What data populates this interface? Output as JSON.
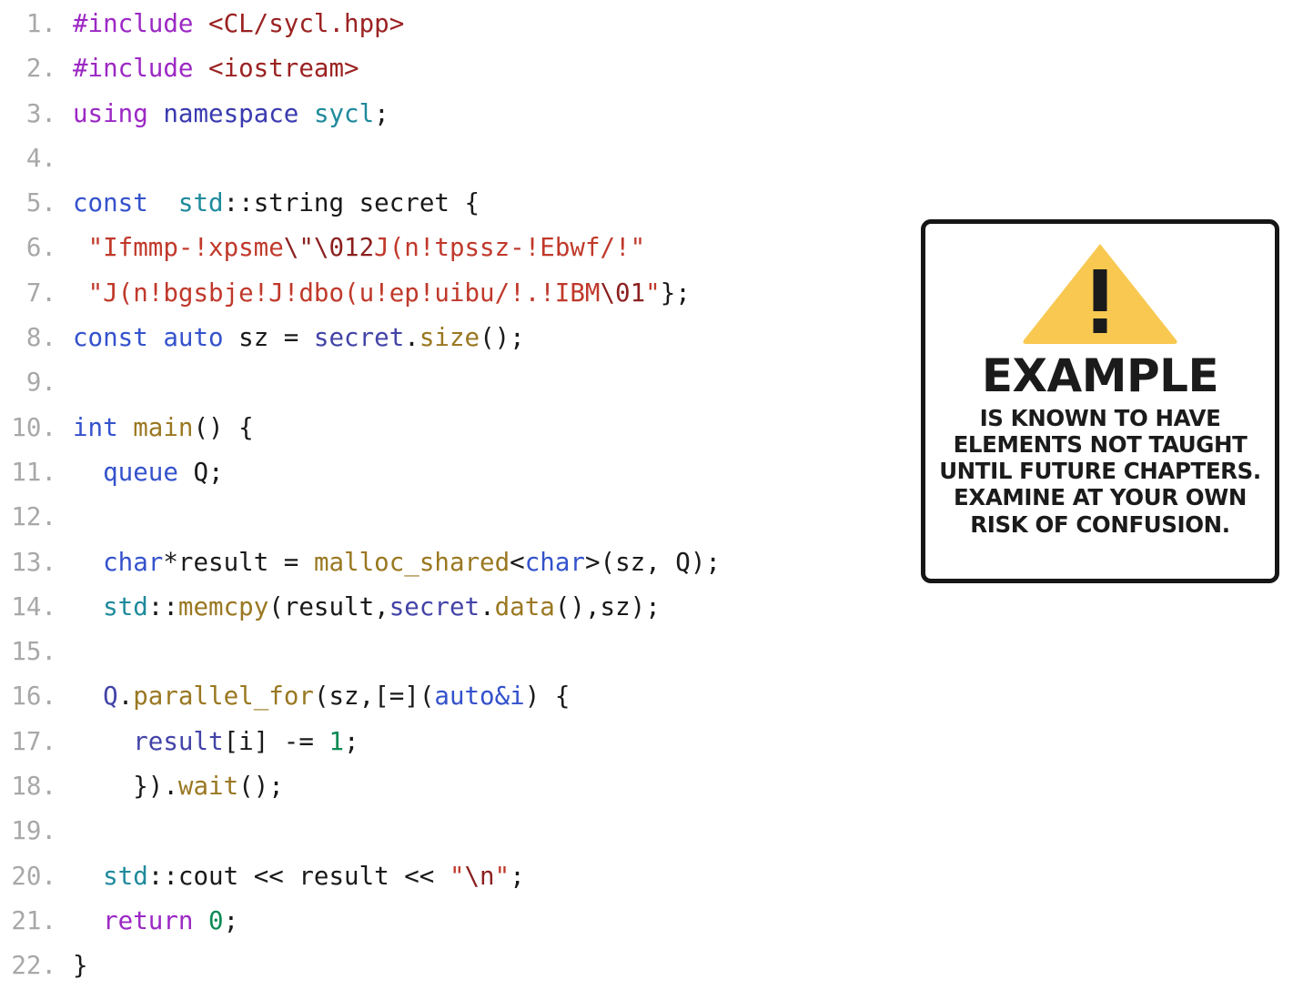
{
  "code": {
    "language": "C++ (SYCL)",
    "lines": [
      {
        "n": "1.",
        "tokens": [
          {
            "t": "#include ",
            "c": "t-pre"
          },
          {
            "t": "<CL/sycl.hpp>",
            "c": "t-inc"
          }
        ]
      },
      {
        "n": "2.",
        "tokens": [
          {
            "t": "#include ",
            "c": "t-pre"
          },
          {
            "t": "<iostream>",
            "c": "t-inc"
          }
        ]
      },
      {
        "n": "3.",
        "tokens": [
          {
            "t": "using",
            "c": "t-pre"
          },
          {
            "t": " ",
            "c": "t-plain"
          },
          {
            "t": "namespace",
            "c": "t-ns"
          },
          {
            "t": " ",
            "c": "t-plain"
          },
          {
            "t": "sycl",
            "c": "t-type"
          },
          {
            "t": ";",
            "c": "t-plain"
          }
        ]
      },
      {
        "n": "4.",
        "tokens": []
      },
      {
        "n": "5.",
        "tokens": [
          {
            "t": "const",
            "c": "t-kw"
          },
          {
            "t": "  ",
            "c": "t-plain"
          },
          {
            "t": "std",
            "c": "t-type"
          },
          {
            "t": "::string secret {",
            "c": "t-plain"
          }
        ]
      },
      {
        "n": "6.",
        "tokens": [
          {
            "t": " ",
            "c": "t-plain"
          },
          {
            "t": "\"Ifmmp-!xpsme",
            "c": "t-str"
          },
          {
            "t": "\\\"",
            "c": "t-esc"
          },
          {
            "t": "\\012",
            "c": "t-esc"
          },
          {
            "t": "J(n!tpssz-!Ebwf/!\"",
            "c": "t-str"
          }
        ]
      },
      {
        "n": "7.",
        "tokens": [
          {
            "t": " ",
            "c": "t-plain"
          },
          {
            "t": "\"J(n!bgsbje!J!dbo(u!ep!uibu/!.!IBM",
            "c": "t-str"
          },
          {
            "t": "\\01",
            "c": "t-esc"
          },
          {
            "t": "\"",
            "c": "t-str"
          },
          {
            "t": "};",
            "c": "t-plain"
          }
        ]
      },
      {
        "n": "8.",
        "tokens": [
          {
            "t": "const auto",
            "c": "t-kw"
          },
          {
            "t": " sz = ",
            "c": "t-plain"
          },
          {
            "t": "secret",
            "c": "t-var"
          },
          {
            "t": ".",
            "c": "t-plain"
          },
          {
            "t": "size",
            "c": "t-fn"
          },
          {
            "t": "();",
            "c": "t-plain"
          }
        ]
      },
      {
        "n": "9.",
        "tokens": []
      },
      {
        "n": "10.",
        "tokens": [
          {
            "t": "int",
            "c": "t-kw"
          },
          {
            "t": " ",
            "c": "t-plain"
          },
          {
            "t": "main",
            "c": "t-fn"
          },
          {
            "t": "() {",
            "c": "t-plain"
          }
        ]
      },
      {
        "n": "11.",
        "tokens": [
          {
            "t": "  ",
            "c": "t-plain"
          },
          {
            "t": "queue",
            "c": "t-kw"
          },
          {
            "t": " Q;",
            "c": "t-plain"
          }
        ]
      },
      {
        "n": "12.",
        "tokens": []
      },
      {
        "n": "13.",
        "tokens": [
          {
            "t": "  ",
            "c": "t-plain"
          },
          {
            "t": "char",
            "c": "t-kw"
          },
          {
            "t": "*result = ",
            "c": "t-plain"
          },
          {
            "t": "malloc_shared",
            "c": "t-fn"
          },
          {
            "t": "<",
            "c": "t-plain"
          },
          {
            "t": "char",
            "c": "t-kw"
          },
          {
            "t": ">(sz, Q);",
            "c": "t-plain"
          }
        ]
      },
      {
        "n": "14.",
        "tokens": [
          {
            "t": "  ",
            "c": "t-plain"
          },
          {
            "t": "std",
            "c": "t-type"
          },
          {
            "t": "::",
            "c": "t-plain"
          },
          {
            "t": "memcpy",
            "c": "t-fn"
          },
          {
            "t": "(result,",
            "c": "t-plain"
          },
          {
            "t": "secret",
            "c": "t-var"
          },
          {
            "t": ".",
            "c": "t-plain"
          },
          {
            "t": "data",
            "c": "t-fn"
          },
          {
            "t": "(),sz);",
            "c": "t-plain"
          }
        ]
      },
      {
        "n": "15.",
        "tokens": []
      },
      {
        "n": "16.",
        "tokens": [
          {
            "t": "  ",
            "c": "t-plain"
          },
          {
            "t": "Q",
            "c": "t-var"
          },
          {
            "t": ".",
            "c": "t-plain"
          },
          {
            "t": "parallel_for",
            "c": "t-fn"
          },
          {
            "t": "(sz,[=](",
            "c": "t-plain"
          },
          {
            "t": "auto&i",
            "c": "t-kw"
          },
          {
            "t": ") {",
            "c": "t-plain"
          }
        ]
      },
      {
        "n": "17.",
        "tokens": [
          {
            "t": "    ",
            "c": "t-plain"
          },
          {
            "t": "result",
            "c": "t-var"
          },
          {
            "t": "[i] -= ",
            "c": "t-plain"
          },
          {
            "t": "1",
            "c": "t-num"
          },
          {
            "t": ";",
            "c": "t-plain"
          }
        ]
      },
      {
        "n": "18.",
        "tokens": [
          {
            "t": "    }).",
            "c": "t-plain"
          },
          {
            "t": "wait",
            "c": "t-fn"
          },
          {
            "t": "();",
            "c": "t-plain"
          }
        ]
      },
      {
        "n": "19.",
        "tokens": []
      },
      {
        "n": "20.",
        "tokens": [
          {
            "t": "  ",
            "c": "t-plain"
          },
          {
            "t": "std",
            "c": "t-type"
          },
          {
            "t": "::cout << result << ",
            "c": "t-plain"
          },
          {
            "t": "\"",
            "c": "t-str"
          },
          {
            "t": "\\n",
            "c": "t-esc"
          },
          {
            "t": "\"",
            "c": "t-str"
          },
          {
            "t": ";",
            "c": "t-plain"
          }
        ]
      },
      {
        "n": "21.",
        "tokens": [
          {
            "t": "  ",
            "c": "t-plain"
          },
          {
            "t": "return",
            "c": "t-pre"
          },
          {
            "t": " ",
            "c": "t-plain"
          },
          {
            "t": "0",
            "c": "t-num"
          },
          {
            "t": ";",
            "c": "t-plain"
          }
        ]
      },
      {
        "n": "22.",
        "tokens": [
          {
            "t": "}",
            "c": "t-plain"
          }
        ]
      }
    ]
  },
  "warning": {
    "icon": "warning-triangle-exclamation-icon",
    "triangle_color": "#F8C851",
    "exclamation_color": "#1b1b1b",
    "border_color": "#161616",
    "heading": "EXAMPLE",
    "body_lines": [
      "IS KNOWN TO HAVE",
      "ELEMENTS NOT TAUGHT",
      "UNTIL FUTURE CHAPTERS.",
      "EXAMINE AT YOUR OWN",
      "RISK OF CONFUSION."
    ]
  }
}
